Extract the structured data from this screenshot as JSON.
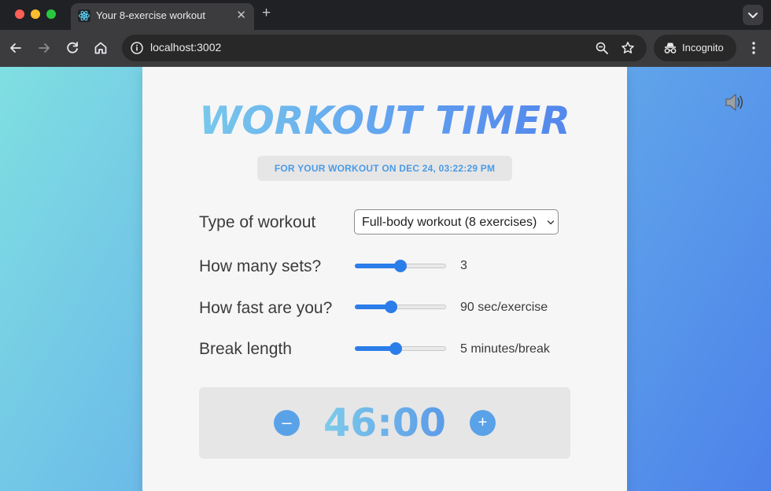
{
  "browser": {
    "tab_title": "Your 8-exercise workout",
    "url": "localhost:3002",
    "incognito_label": "Incognito"
  },
  "page": {
    "title": "WORKOUT TIMER",
    "date_line": "FOR YOUR WORKOUT ON DEC 24, 03:22:29 PM",
    "workout_type": {
      "label": "Type of workout",
      "selected": "Full-body workout (8 exercises)"
    },
    "sets": {
      "label": "How many sets?",
      "value_text": "3",
      "fraction": 0.5
    },
    "speed": {
      "label": "How fast are you?",
      "value_text": "90 sec/exercise",
      "fraction": 0.4
    },
    "break_length": {
      "label": "Break length",
      "value_text": "5 minutes/break",
      "fraction": 0.45
    },
    "timer": {
      "time": "46:00",
      "minus": "–",
      "plus": "+"
    }
  },
  "colors": {
    "accent": "#2b7de9",
    "timer_button": "#5aa2e8",
    "date_text": "#4c9be6"
  },
  "icons": [
    "react-icon",
    "close-icon",
    "plus-icon",
    "chevron-down-icon",
    "back-arrow-icon",
    "forward-arrow-icon",
    "reload-icon",
    "home-icon",
    "info-icon",
    "zoom-icon",
    "star-icon",
    "incognito-icon",
    "more-vert-icon",
    "speaker-icon"
  ]
}
